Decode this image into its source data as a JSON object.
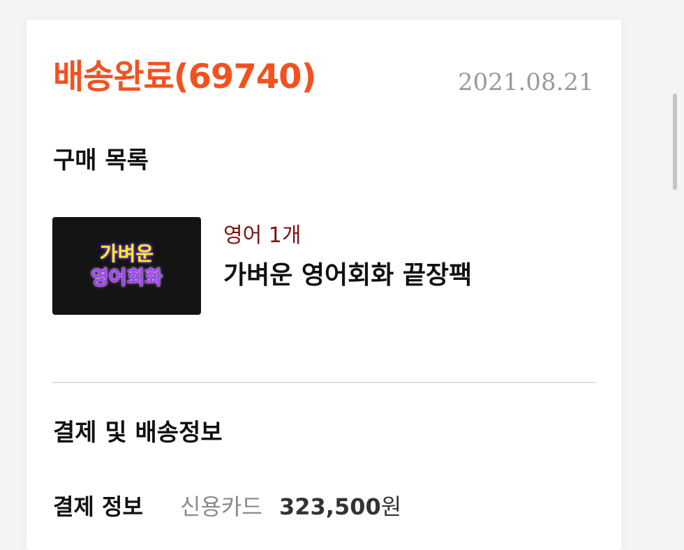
{
  "order": {
    "status": "배송완료(69740)",
    "date": "2021.08.21"
  },
  "purchase": {
    "heading": "구매 목록",
    "items": [
      {
        "thumbnail_text_line1": "가벼운",
        "thumbnail_text_line2": "영어회화",
        "option": "영어 1개",
        "name": "가벼운 영어회화 끝장팩"
      }
    ]
  },
  "payment": {
    "heading": "결제 및 배송정보",
    "label": "결제 정보",
    "method": "신용카드",
    "amount": "323,500",
    "currency": "원"
  },
  "colors": {
    "status": "#f4511e",
    "option": "#7a1212",
    "thumb_bg": "#141414",
    "thumb_line1": "#f3f01a",
    "thumb_line2": "#a63cff"
  }
}
